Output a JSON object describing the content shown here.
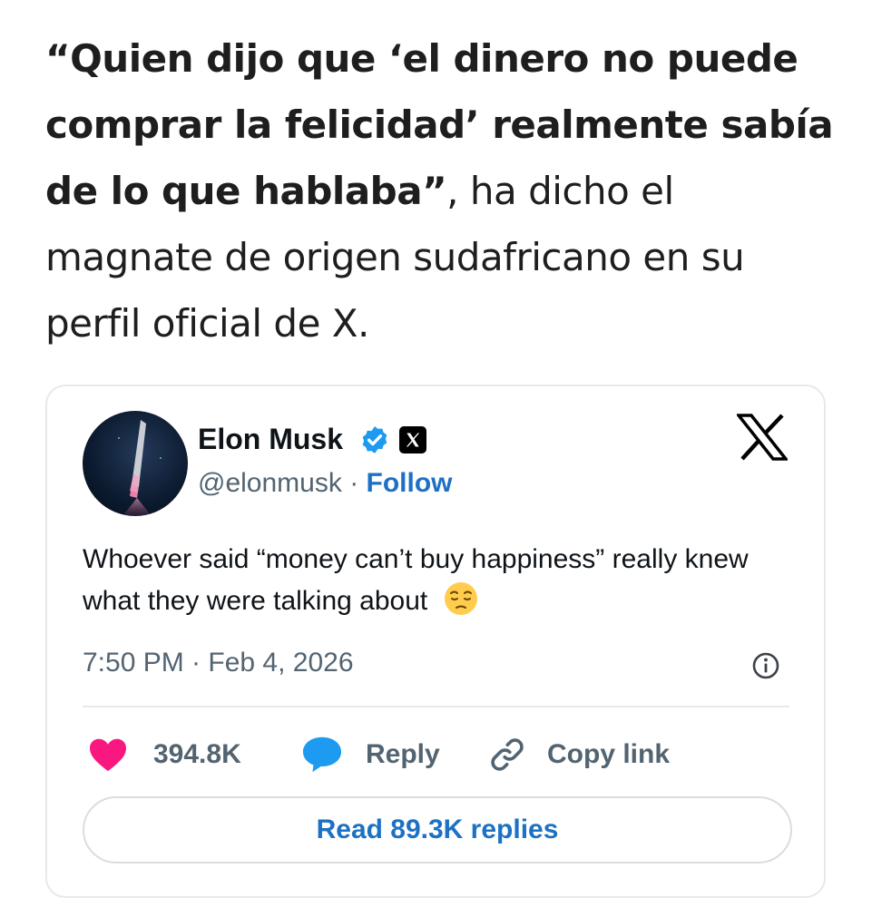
{
  "article": {
    "quote": "“Quien dijo que ‘el dinero no puede comprar la felicidad’ realmente sabía de lo que hablaba”",
    "rest": ", ha dicho el magnate de origen sudafricano en su perfil oficial de X."
  },
  "tweet": {
    "author_name": "Elon Musk",
    "handle": "@elonmusk",
    "separator": " · ",
    "follow_label": "Follow",
    "text": "Whoever said “money can’t buy happiness” really knew what they were talking about",
    "emoji_icon": "pensive-face-icon",
    "timestamp": "7:50 PM · Feb 4, 2026",
    "actions": {
      "like_count": "394.8K",
      "reply_label": "Reply",
      "copy_label": "Copy link"
    },
    "read_replies_label": "Read 89.3K replies"
  },
  "colors": {
    "like": "#f91880",
    "reply": "#1d9bf0",
    "link_blue": "#1d71c4",
    "muted": "#536471"
  }
}
